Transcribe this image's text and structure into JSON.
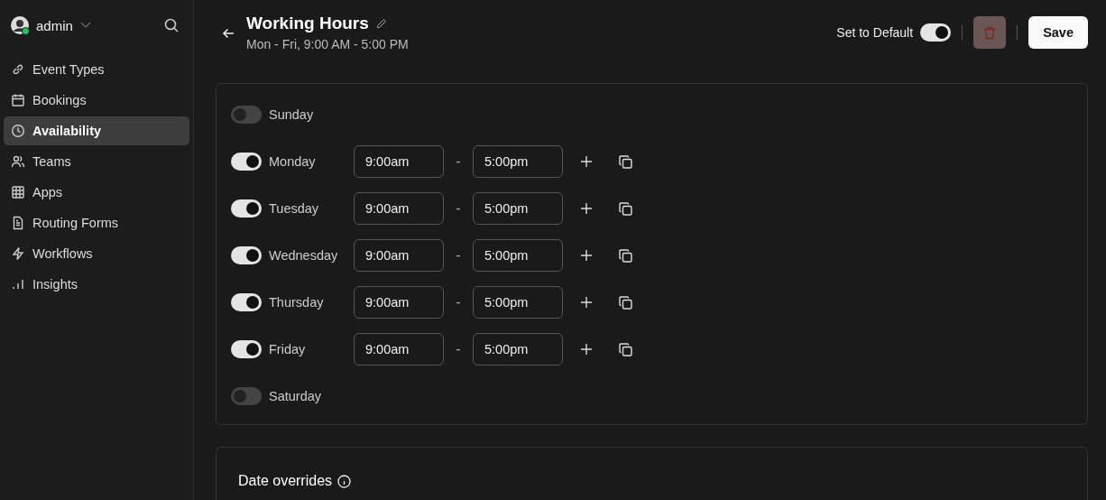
{
  "sidebar": {
    "user": {
      "name": "admin",
      "online": true
    },
    "items": [
      {
        "label": "Event Types",
        "kind": "link",
        "selected": false
      },
      {
        "label": "Bookings",
        "kind": "calendar",
        "selected": false
      },
      {
        "label": "Availability",
        "kind": "clock",
        "selected": true
      },
      {
        "label": "Teams",
        "kind": "users",
        "selected": false
      },
      {
        "label": "Apps",
        "kind": "grid",
        "selected": false
      },
      {
        "label": "Routing Forms",
        "kind": "file",
        "selected": false
      },
      {
        "label": "Workflows",
        "kind": "bolt",
        "selected": false
      },
      {
        "label": "Insights",
        "kind": "bars",
        "selected": false
      }
    ]
  },
  "header": {
    "title": "Working Hours",
    "subtitle": "Mon - Fri, 9:00 AM - 5:00 PM",
    "default_label": "Set to Default",
    "default_on": true,
    "save": "Save"
  },
  "days": [
    {
      "name": "Sunday",
      "on": false
    },
    {
      "name": "Monday",
      "on": true,
      "start": "9:00am",
      "sep": "-",
      "end": "5:00pm"
    },
    {
      "name": "Tuesday",
      "on": true,
      "start": "9:00am",
      "sep": "-",
      "end": "5:00pm"
    },
    {
      "name": "Wednesday",
      "on": true,
      "start": "9:00am",
      "sep": "-",
      "end": "5:00pm"
    },
    {
      "name": "Thursday",
      "on": true,
      "start": "9:00am",
      "sep": "-",
      "end": "5:00pm"
    },
    {
      "name": "Friday",
      "on": true,
      "start": "9:00am",
      "sep": "-",
      "end": "5:00pm"
    },
    {
      "name": "Saturday",
      "on": false
    }
  ],
  "overrides": {
    "title": "Date overrides"
  }
}
